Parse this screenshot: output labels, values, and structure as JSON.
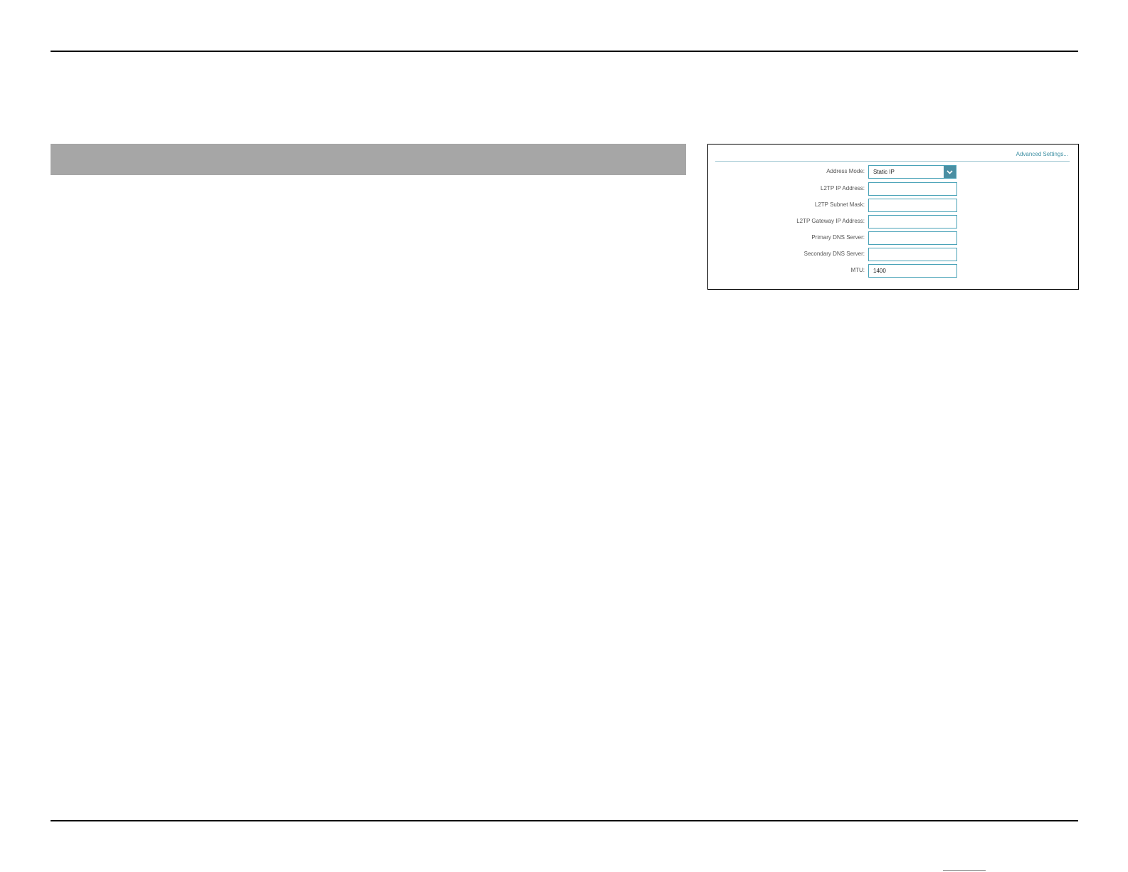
{
  "panel": {
    "advanced_link": "Advanced Settings...",
    "fields": [
      {
        "label": "Address Mode:",
        "type": "select",
        "value": "Static IP"
      },
      {
        "label": "L2TP IP Address:",
        "type": "input",
        "value": ""
      },
      {
        "label": "L2TP Subnet Mask:",
        "type": "input",
        "value": ""
      },
      {
        "label": "L2TP Gateway IP Address:",
        "type": "input",
        "value": ""
      },
      {
        "label": "Primary DNS Server:",
        "type": "input",
        "value": ""
      },
      {
        "label": "Secondary DNS Server:",
        "type": "input",
        "value": ""
      },
      {
        "label": "MTU:",
        "type": "input",
        "value": "1400"
      }
    ]
  },
  "icons": {
    "select_arrow": "chevron-down-icon"
  },
  "colors": {
    "accent": "#4a8fa3",
    "input_border": "#4aa3b8",
    "section_bar": "#a6a6a6"
  }
}
